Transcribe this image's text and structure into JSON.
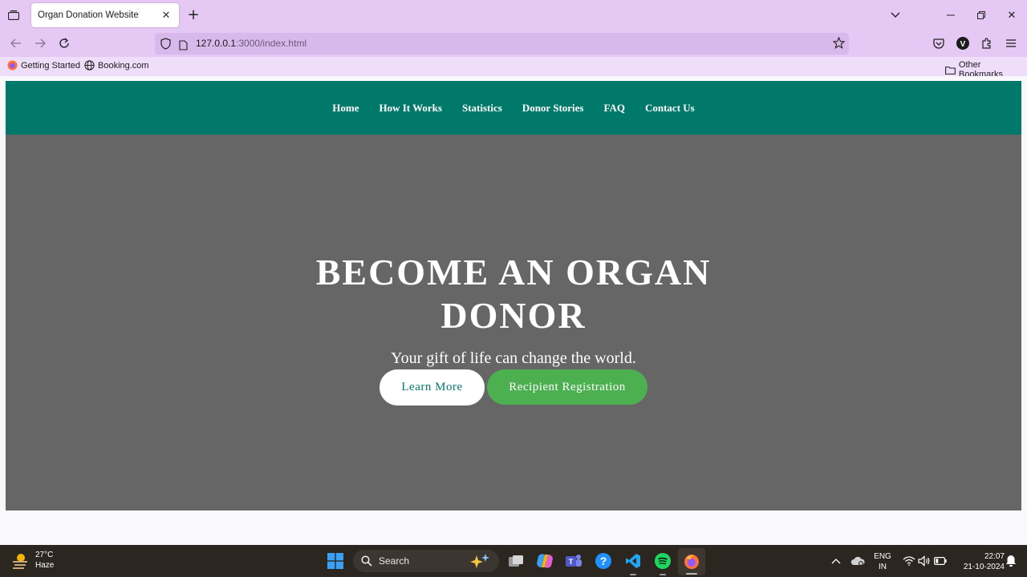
{
  "browser": {
    "tab_title": "Organ Donation Website",
    "url_host": "127.0.0.1",
    "url_path": ":3000/index.html",
    "bookmarks": [
      {
        "label": "Getting Started"
      },
      {
        "label": "Booking.com"
      }
    ],
    "other_bookmarks": "Other Bookmarks"
  },
  "site": {
    "nav": [
      "Home",
      "How It Works",
      "Statistics",
      "Donor Stories",
      "FAQ",
      "Contact Us"
    ],
    "hero_title": "BECOME AN ORGAN DONOR",
    "hero_subtitle": "Your gift of life can change the world.",
    "learn_more": "Learn More",
    "register": "Recipient Registration"
  },
  "taskbar": {
    "temperature": "27°C",
    "condition": "Haze",
    "search_placeholder": "Search",
    "lang_top": "ENG",
    "lang_bottom": "IN",
    "time": "22:07",
    "date": "21-10-2024"
  },
  "colors": {
    "nav_bg": "#00796b",
    "hero_bg": "#666666",
    "register_btn": "#4caf50",
    "chrome_bg": "#e6c8f5"
  }
}
